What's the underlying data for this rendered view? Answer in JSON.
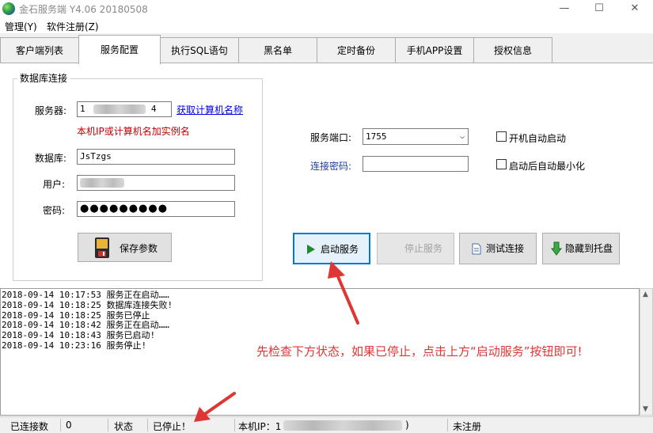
{
  "window": {
    "title": "金石服务端 Y4.06 20180508",
    "minimize": "—",
    "maximize": "☐",
    "close": "✕"
  },
  "menu": [
    "管理(Y)",
    "软件注册(Z)"
  ],
  "tabs": [
    "客户端列表",
    "服务配置",
    "执行SQL语句",
    "黑名单",
    "定时备份",
    "手机APP设置",
    "授权信息"
  ],
  "active_tab": 1,
  "db": {
    "group_title": "数据库连接",
    "server_label": "服务器:",
    "server_prefix": "1",
    "server_suffix": "4",
    "get_name_link": "获取计算机名称",
    "hint": "本机IP或计算机名加实例名",
    "database_label": "数据库:",
    "database_value": "JsTzgs",
    "user_label": "用户:",
    "password_label": "密码:",
    "password_mask": "●●●●●●●●●",
    "save_button": "保存参数"
  },
  "service": {
    "port_label": "服务端口:",
    "port_value": "1755",
    "conn_password_label": "连接密码:",
    "conn_password_value": "",
    "autostart_label": "开机自动启动",
    "minimize_label": "启动后自动最小化",
    "start_button": "启动服务",
    "stop_button": "停止服务",
    "test_button": "测试连接",
    "hide_button": "隐藏到托盘"
  },
  "log": [
    "2018-09-14 10:17:53 服务正在启动……",
    "2018-09-14 10:18:25 数据库连接失败!",
    "2018-09-14 10:18:25 服务已停止",
    "2018-09-14 10:18:42 服务正在启动……",
    "2018-09-14 10:18:43 服务已启动!",
    "2018-09-14 10:23:16 服务停止!"
  ],
  "annotation": "先检查下方状态，如果已停止，点击上方“启动服务”按钮即可!",
  "status": {
    "connected_label": "已连接数",
    "connected_value": "0",
    "state_label": "状态",
    "state_value": "已停止！",
    "ip_label": "本机IP：1",
    "ip_suffix": ")",
    "registration": "未注册"
  },
  "colors": {
    "accent": "#0078d7",
    "annotation": "#e03535",
    "hint": "#c00000",
    "link": "#0000ee"
  }
}
